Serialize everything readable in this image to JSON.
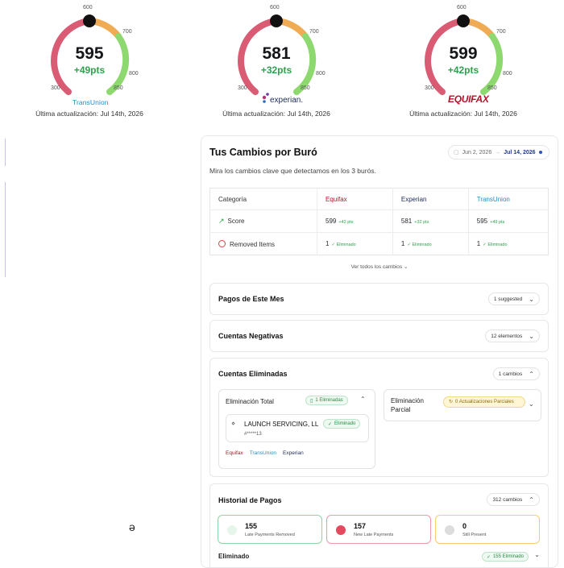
{
  "gauges": [
    {
      "score": "595",
      "delta": "+49pts",
      "brand": "TransUnion",
      "updated": "Última actualización: Jul 14th, 2026",
      "ticks": [
        "300",
        "600",
        "700",
        "800",
        "850"
      ]
    },
    {
      "score": "581",
      "delta": "+32pts",
      "brand": "experian.",
      "updated": "Última actualización: Jul 14th, 2026",
      "ticks": [
        "300",
        "600",
        "700",
        "800",
        "850"
      ]
    },
    {
      "score": "599",
      "delta": "+42pts",
      "brand": "EQUIFAX",
      "updated": "Última actualización: Jul 14th, 2026",
      "ticks": [
        "300",
        "600",
        "700",
        "800",
        "850"
      ]
    }
  ],
  "colors": {
    "red": "#d95c74",
    "orange": "#efac54",
    "green": "#8ed96f",
    "needle": "#111111"
  },
  "panel": {
    "title": "Tus Cambios por Buró",
    "subtitle": "Mira los cambios clave que detectamos en los 3 burós.",
    "date_from": "Jun 2, 2026",
    "date_to": "Jul 14, 2026",
    "table": {
      "headers": [
        "Categoría",
        "Equifax",
        "Experian",
        "TransUnion"
      ],
      "rows": [
        {
          "label": "Score",
          "values": [
            "599",
            "581",
            "595"
          ],
          "notes": [
            "+42 pts",
            "+32 pts",
            "+49 pts"
          ]
        },
        {
          "label": "Removed Items",
          "values": [
            "1",
            "1",
            "1"
          ],
          "notes": [
            "✓ Eliminado",
            "✓ Eliminado",
            "✓ Eliminado"
          ]
        }
      ]
    },
    "see_all": "Ver todos los cambios",
    "sections": {
      "payments": {
        "title": "Pagos de Este Mes",
        "pill": "1 suggested"
      },
      "negative": {
        "title": "Cuentas Negativas",
        "pill": "12 elementos"
      },
      "removed": {
        "title": "Cuentas Eliminadas",
        "pill": "1 cambios",
        "total": {
          "title": "Eliminación Total",
          "tag": "1 Eliminadas",
          "account": {
            "name": "LAUNCH SERVICING, LL",
            "status": "Eliminado",
            "number": "#*****13",
            "bureaus": [
              "Equifax",
              "TransUnion",
              "Experian"
            ]
          }
        },
        "partial": {
          "title": "Eliminación Parcial",
          "tag": "0 Actualizaciones Parciales"
        }
      },
      "history": {
        "title": "Historial de Pagos",
        "pill": "312 cambios",
        "stats": [
          {
            "number": "155",
            "label": "Late Payments Removed"
          },
          {
            "number": "157",
            "label": "New Late Payments"
          },
          {
            "number": "0",
            "label": "Still Present"
          }
        ],
        "eliminated_label": "Eliminado",
        "eliminated_tag": "155 Eliminado"
      }
    }
  },
  "stray_char": "ǝ"
}
